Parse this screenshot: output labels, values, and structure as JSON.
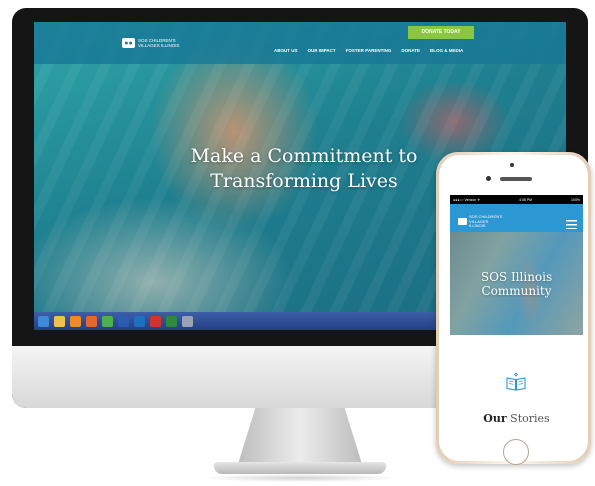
{
  "desktop": {
    "header": {
      "donate_label": "DONATE TODAY",
      "logo_lines": "SOS CHILDREN'S VILLAGES ILLINOIS",
      "nav": [
        "ABOUT US",
        "OUR IMPACT",
        "FOSTER PARENTING",
        "DONATE",
        "BLOG & MEDIA"
      ]
    },
    "hero": {
      "title_line1": "Make a Commitment to",
      "title_line2": "Transforming Lives"
    },
    "taskbar_icons": [
      "ie-icon",
      "folder-icon",
      "media-icon",
      "firefox-icon",
      "chrome-icon",
      "word-icon",
      "outlook-icon",
      "opera-icon",
      "excel-icon",
      "app-icon"
    ]
  },
  "phone": {
    "status": {
      "carrier": "●●●○○ Verizon ✈",
      "time": "4:08 PM",
      "battery": "100%"
    },
    "logo_lines": "SOS CHILDREN'S VILLAGES ILLINOIS",
    "hero": {
      "line1": "SOS Illinois",
      "line2": "Community"
    },
    "stories": {
      "emph": "Our",
      "rest": "Stories"
    }
  },
  "colors": {
    "header_overlay": "#1978a0",
    "donate_green": "#8cc63f",
    "phone_header": "#2b97d3",
    "icon_blue": "#2b97d3"
  }
}
